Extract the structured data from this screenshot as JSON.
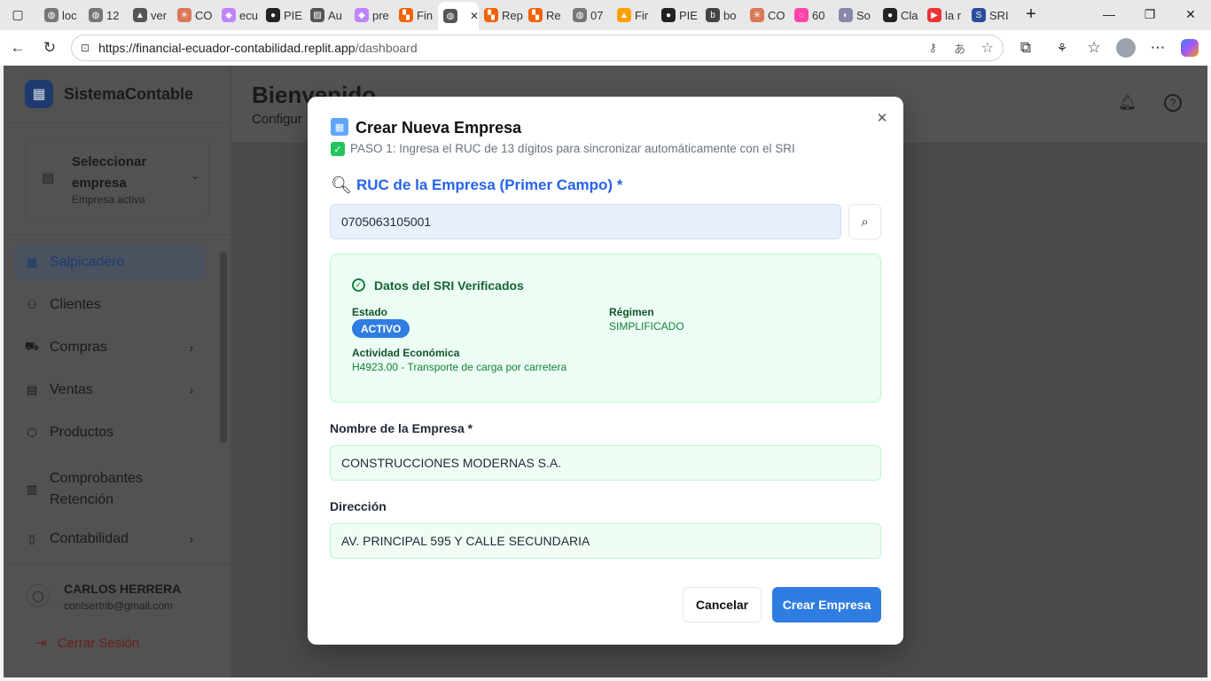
{
  "browser": {
    "tabs": [
      {
        "label": "loc",
        "fav": "globe-icon",
        "color": "#777"
      },
      {
        "label": "12",
        "fav": "globe-icon",
        "color": "#777"
      },
      {
        "label": "ver",
        "fav": "vercel-icon",
        "color": "#555"
      },
      {
        "label": "CO",
        "fav": "claude-icon",
        "color": "#d97757"
      },
      {
        "label": "ecu",
        "fav": "folder-icon",
        "color": "#c084fc"
      },
      {
        "label": "PIE",
        "fav": "github-icon",
        "color": "#222"
      },
      {
        "label": "Au",
        "fav": "chart-icon",
        "color": "#555"
      },
      {
        "label": "pre",
        "fav": "folder-icon",
        "color": "#c084fc"
      },
      {
        "label": "Fin",
        "fav": "replit-icon",
        "color": "#f26207"
      },
      {
        "label": "",
        "fav": "globe-icon",
        "color": "#555",
        "active": true
      },
      {
        "label": "Rep",
        "fav": "replit-icon",
        "color": "#f26207"
      },
      {
        "label": "Re",
        "fav": "replit-icon",
        "color": "#f26207"
      },
      {
        "label": "07",
        "fav": "globe-icon",
        "color": "#777"
      },
      {
        "label": "Fir",
        "fav": "firebase-icon",
        "color": "#ffa000"
      },
      {
        "label": "PIE",
        "fav": "github-icon",
        "color": "#222"
      },
      {
        "label": "bo",
        "fav": "b-icon",
        "color": "#444"
      },
      {
        "label": "CO",
        "fav": "claude-icon",
        "color": "#d97757"
      },
      {
        "label": "60",
        "fav": "circle-icon",
        "color": "#f4a"
      },
      {
        "label": "So",
        "fav": "sol-icon",
        "color": "#88a"
      },
      {
        "label": "Cla",
        "fav": "github-icon",
        "color": "#222"
      },
      {
        "label": "la r",
        "fav": "youtube-icon",
        "color": "#e33"
      },
      {
        "label": "SRI",
        "fav": "sri-icon",
        "color": "#2b4d9b"
      }
    ],
    "url_base": "https://financial-ecuador-contabilidad.replit.app",
    "url_path": "/dashboard"
  },
  "sidebar": {
    "brand": "SistemaContable",
    "company_select": {
      "title": "Seleccionar empresa",
      "subtitle": "Empresa activa"
    },
    "items": [
      {
        "label": "Salpicadero",
        "icon": "grid-icon",
        "active": true,
        "chevron": false
      },
      {
        "label": "Clientes",
        "icon": "users-icon",
        "chevron": false
      },
      {
        "label": "Compras",
        "icon": "cart-icon",
        "chevron": true
      },
      {
        "label": "Ventas",
        "icon": "receipt-icon",
        "chevron": true
      },
      {
        "label": "Productos",
        "icon": "box-icon",
        "chevron": false
      },
      {
        "label": "Comprobantes Retención",
        "icon": "document-icon",
        "chevron": false
      },
      {
        "label": "Contabilidad",
        "icon": "book-icon",
        "chevron": true
      }
    ],
    "user": {
      "name": "CARLOS HERRERA",
      "email": "contsertrib@gmail.com"
    },
    "logout": "Cerrar Sesión"
  },
  "header": {
    "title": "Bienvenido",
    "subtitle": "Configur"
  },
  "modal": {
    "title": "Crear Nueva Empresa",
    "step": "PASO 1: Ingresa el RUC de 13 dígitos para sincronizar automáticamente con el SRI",
    "ruc_label": "RUC de la Empresa (Primer Campo) *",
    "ruc_value": "0705063105001",
    "sri": {
      "title": "Datos del SRI Verificados",
      "estado_label": "Estado",
      "estado_value": "ACTIVO",
      "regimen_label": "Régimen",
      "regimen_value": "SIMPLIFICADO",
      "actividad_label": "Actividad Económica",
      "actividad_value": "H4923.00 - Transporte de carga por carretera"
    },
    "nombre_label": "Nombre de la Empresa *",
    "nombre_value": "CONSTRUCCIONES MODERNAS S.A.",
    "direccion_label": "Dirección",
    "direccion_value": "AV. PRINCIPAL 595 Y CALLE SECUNDARIA",
    "cancel": "Cancelar",
    "create": "Crear Empresa"
  },
  "colors": {
    "accent": "#2f7de1",
    "success_bg": "#ecfdf3",
    "success_border": "#bbf7d0",
    "success_text": "#15803d"
  }
}
